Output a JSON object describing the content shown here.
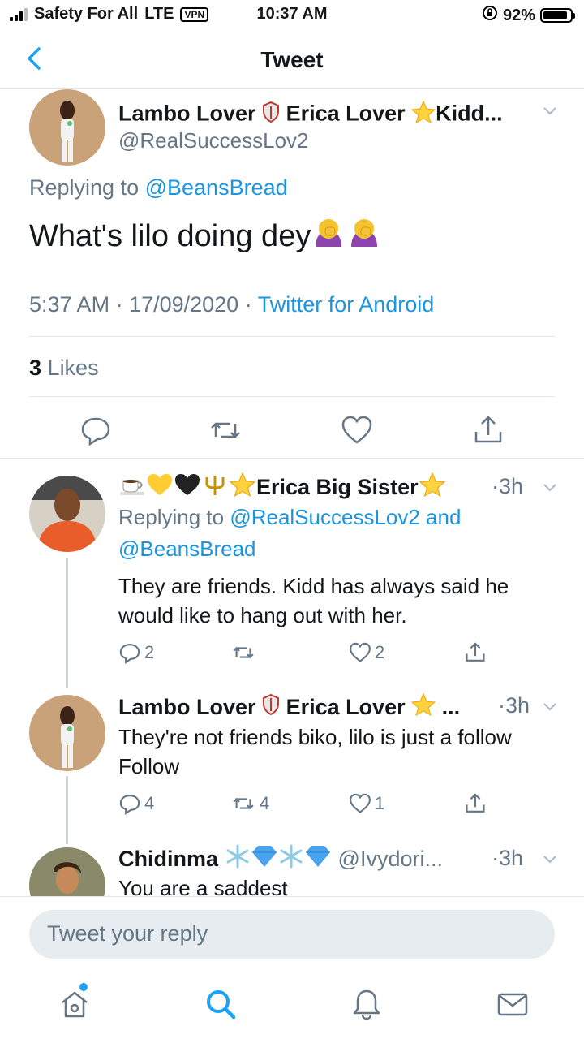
{
  "status": {
    "carrier": "Safety For All",
    "network": "LTE",
    "vpn": "VPN",
    "time": "10:37 AM",
    "battery": "92%",
    "battery_level": 0.92
  },
  "nav": {
    "title": "Tweet"
  },
  "main_tweet": {
    "name_a": "Lambo Lover",
    "name_b": "Erica Lover",
    "name_c": "Kidd...",
    "handle": "@RealSuccessLov2",
    "replying_label": "Replying to",
    "replying_handle": "@BeansBread",
    "text": "What's lilo doing dey",
    "timestamp": "5:37 AM · 17/09/2020 · ",
    "source": "Twitter for Android",
    "likes_count": "3",
    "likes_label": "Likes"
  },
  "replies": [
    {
      "name": "Erica Big Sister",
      "time": "·3h",
      "replying_label": "Replying to",
      "replying_handles": "@RealSuccessLov2 and @BeansBread",
      "text": "They are friends. Kidd has always said he would like to hang out with her.",
      "reply_count": "2",
      "retweet_count": "",
      "like_count": "2"
    },
    {
      "name_a": "Lambo Lover",
      "name_b": "Erica Lover",
      "name_c": "...",
      "time": "·3h",
      "text": "They're not friends biko, lilo is just a follow Follow",
      "reply_count": "4",
      "retweet_count": "4",
      "like_count": "1"
    },
    {
      "name": "Chidinma",
      "handle": "@Ivydori...",
      "time": "·3h",
      "text": "You are a saddest"
    }
  ],
  "compose": {
    "placeholder": "Tweet your reply"
  },
  "colors": {
    "accent": "#1b95e0",
    "muted": "#657786",
    "divider": "#e1e8ed"
  }
}
